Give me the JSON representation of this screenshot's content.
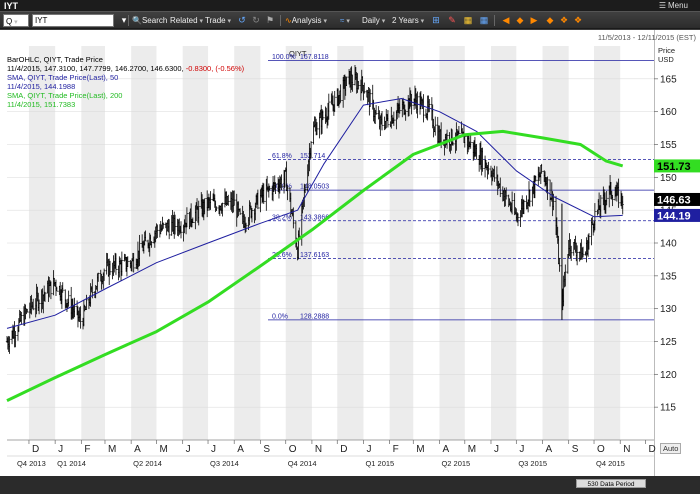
{
  "window": {
    "title": "IYT",
    "menu_label": "Menu"
  },
  "toolbar": {
    "symbol_type": "Q",
    "symbol_value": "IYT",
    "search_label": "Search",
    "related_label": "Related",
    "trade_label": "Trade",
    "analysis_label": "Analysis",
    "interval_label": "Daily",
    "range_label": "2 Years"
  },
  "chart_header": {
    "symbol": "QIYT",
    "date_range": "11/5/2013 - 12/11/2015 (EST)",
    "price_label": "Price",
    "currency_label": "USD"
  },
  "info_panel": {
    "line1": "BarOHLC, QIYT, Trade Price",
    "line2_prefix": "11/4/2015, 147.3100, 147.7799, 146.2700, 146.6300, ",
    "line2_change": "-0.8300, (-0.56%)",
    "line3": "SMA, QIYT, Trade Price(Last), 50",
    "line4": "11/4/2015, 144.1988",
    "line5": "SMA, QIYT, Trade Price(Last), 200",
    "line6": "11/4/2015, 151.7383"
  },
  "colors": {
    "price_bars": "#000000",
    "sma50": "#1f1fa0",
    "sma200": "#33dd22",
    "fib_lines": "#1f1fa0",
    "negative_change": "#d00000"
  },
  "bottom": {
    "data_period_label": "530 Data Period",
    "auto_label": "Auto"
  },
  "chart_data": {
    "type": "bar",
    "series": [
      {
        "name": "QIYT",
        "kind": "ohlc",
        "last": {
          "date": "11/4/2015",
          "open": 147.31,
          "high": 147.7799,
          "low": 146.27,
          "close": 146.63
        },
        "x": [
          "2013-11-05",
          "2013-12-01",
          "2014-01-01",
          "2014-02-01",
          "2014-02-15",
          "2014-03-01",
          "2014-04-01",
          "2014-05-01",
          "2014-06-01",
          "2014-07-01",
          "2014-08-01",
          "2014-08-10",
          "2014-09-01",
          "2014-10-01",
          "2014-10-15",
          "2014-11-01",
          "2014-12-01",
          "2014-12-15",
          "2015-01-01",
          "2015-01-20",
          "2015-02-01",
          "2015-03-01",
          "2015-03-20",
          "2015-04-01",
          "2015-05-01",
          "2015-06-01",
          "2015-07-01",
          "2015-08-01",
          "2015-08-15",
          "2015-08-24",
          "2015-09-01",
          "2015-09-20",
          "2015-10-01",
          "2015-10-20",
          "2015-11-04"
        ],
        "values": [
          125,
          130,
          134,
          128,
          133,
          136,
          137,
          142,
          143,
          146,
          146,
          143,
          147,
          150,
          139,
          157,
          162,
          165,
          164,
          158,
          159,
          162,
          160,
          156,
          156,
          151,
          144,
          151,
          146,
          131,
          140,
          138,
          144,
          148,
          146.63
        ]
      },
      {
        "name": "SMA, QIYT, Trade Price(Last), 50",
        "x": [
          "2013-11-05",
          "2014-01-01",
          "2014-03-01",
          "2014-05-01",
          "2014-07-01",
          "2014-09-01",
          "2014-10-15",
          "2014-11-15",
          "2015-01-01",
          "2015-02-15",
          "2015-04-01",
          "2015-05-15",
          "2015-07-01",
          "2015-08-15",
          "2015-10-01",
          "2015-11-04"
        ],
        "values": [
          127,
          129,
          133,
          137,
          140,
          143,
          145,
          152,
          161,
          162,
          160,
          157,
          151,
          147,
          144,
          144.1988
        ]
      },
      {
        "name": "SMA, QIYT, Trade Price(Last), 200",
        "x": [
          "2013-11-05",
          "2014-01-01",
          "2014-03-01",
          "2014-05-01",
          "2014-07-01",
          "2014-09-01",
          "2014-11-01",
          "2015-01-01",
          "2015-03-01",
          "2015-05-01",
          "2015-06-15",
          "2015-08-01",
          "2015-09-15",
          "2015-10-15",
          "2015-11-04"
        ],
        "values": [
          116,
          119.5,
          123,
          126.5,
          131,
          136.5,
          142,
          148,
          153.5,
          156.5,
          157,
          156,
          155,
          152.5,
          151.7383
        ]
      }
    ],
    "fibonacci": [
      {
        "label": "100.0%",
        "value": "167.8118",
        "level": 167.8118
      },
      {
        "label": "61.8%",
        "value": "152.714",
        "level": 152.714
      },
      {
        "label": "50.0%",
        "value": "148.0503",
        "level": 148.0503
      },
      {
        "label": "38.2%",
        "value": "143.3866",
        "level": 143.3866
      },
      {
        "label": "23.6%",
        "value": "137.6163",
        "level": 137.6163
      },
      {
        "label": "0.0%",
        "value": "128.2888",
        "level": 128.2888
      }
    ],
    "ylim": [
      110,
      170
    ],
    "y_ticks": [
      115,
      120,
      125,
      130,
      135,
      140,
      145,
      150,
      155,
      160,
      165
    ],
    "x_month_ticks": [
      {
        "label": "D",
        "date": "2013-12-01"
      },
      {
        "label": "J",
        "date": "2014-01-01"
      },
      {
        "label": "F",
        "date": "2014-02-01"
      },
      {
        "label": "M",
        "date": "2014-03-01"
      },
      {
        "label": "A",
        "date": "2014-04-01"
      },
      {
        "label": "M",
        "date": "2014-05-01"
      },
      {
        "label": "J",
        "date": "2014-06-01"
      },
      {
        "label": "J",
        "date": "2014-07-01"
      },
      {
        "label": "A",
        "date": "2014-08-01"
      },
      {
        "label": "S",
        "date": "2014-09-01"
      },
      {
        "label": "O",
        "date": "2014-10-01"
      },
      {
        "label": "N",
        "date": "2014-11-01"
      },
      {
        "label": "D",
        "date": "2014-12-01"
      },
      {
        "label": "J",
        "date": "2015-01-01"
      },
      {
        "label": "F",
        "date": "2015-02-01"
      },
      {
        "label": "M",
        "date": "2015-03-01"
      },
      {
        "label": "A",
        "date": "2015-04-01"
      },
      {
        "label": "M",
        "date": "2015-05-01"
      },
      {
        "label": "J",
        "date": "2015-06-01"
      },
      {
        "label": "J",
        "date": "2015-07-01"
      },
      {
        "label": "A",
        "date": "2015-08-01"
      },
      {
        "label": "S",
        "date": "2015-09-01"
      },
      {
        "label": "O",
        "date": "2015-10-01"
      },
      {
        "label": "N",
        "date": "2015-11-01"
      },
      {
        "label": "D",
        "date": "2015-12-01"
      }
    ],
    "x_quarter_ticks": [
      {
        "label": "Q4 2013",
        "date": "2013-11-05"
      },
      {
        "label": "Q1 2014",
        "date": "2014-01-01"
      },
      {
        "label": "Q2 2014",
        "date": "2014-04-01"
      },
      {
        "label": "Q3 2014",
        "date": "2014-07-01"
      },
      {
        "label": "Q4 2014",
        "date": "2014-10-01"
      },
      {
        "label": "Q1 2015",
        "date": "2015-01-01"
      },
      {
        "label": "Q2 2015",
        "date": "2015-04-01"
      },
      {
        "label": "Q3 2015",
        "date": "2015-07-01"
      },
      {
        "label": "Q4 2015",
        "date": "2015-10-01"
      }
    ],
    "axis_badges": [
      {
        "series": "SMA 200",
        "text": "151.73",
        "value": 151.7383,
        "bg": "#33dd22",
        "fg": "#000000"
      },
      {
        "series": "Price",
        "text": "146.63",
        "value": 146.63,
        "bg": "#000000",
        "fg": "#ffffff"
      },
      {
        "series": "SMA 50",
        "text": "144.19",
        "value": 144.1988,
        "bg": "#1f1fa0",
        "fg": "#ffffff"
      }
    ],
    "xlim": [
      "2013-11-05",
      "2015-12-11"
    ],
    "grid": true,
    "legend": "top-left"
  }
}
